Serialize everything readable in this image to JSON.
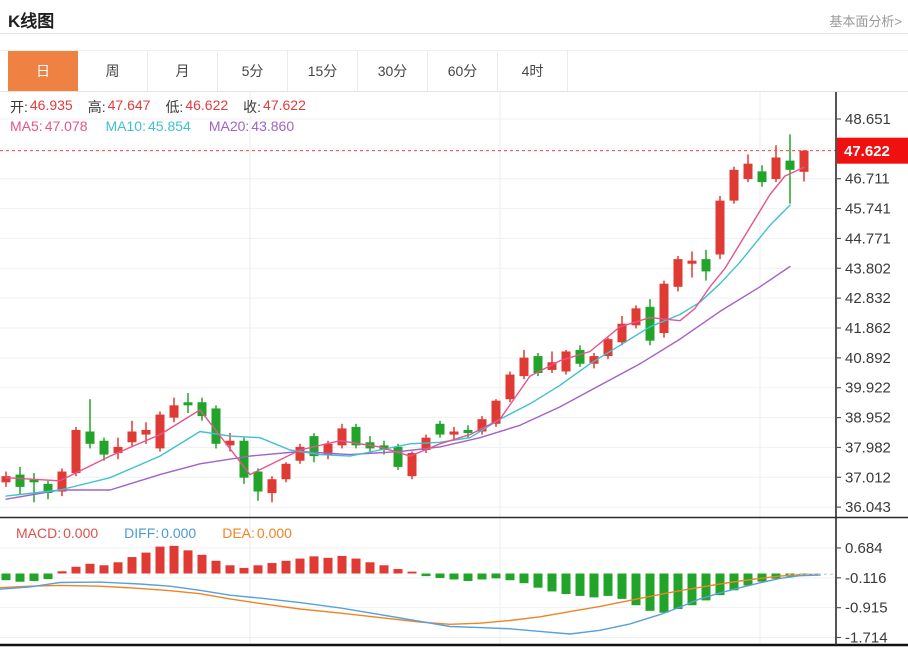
{
  "header": {
    "title": "K线图",
    "link": "基本面分析>"
  },
  "tabs": {
    "items": [
      "日",
      "周",
      "月",
      "5分",
      "15分",
      "30分",
      "60分",
      "4时"
    ],
    "active_index": 0,
    "active_bg": "#ef8143"
  },
  "ohlc": {
    "value_color": "#e13c3c",
    "items": [
      {
        "label": "开:",
        "value": "46.935"
      },
      {
        "label": "高:",
        "value": "47.647"
      },
      {
        "label": "低:",
        "value": "46.622"
      },
      {
        "label": "收:",
        "value": "47.622"
      }
    ]
  },
  "ma": {
    "items": [
      {
        "label": "MA5:",
        "value": "47.078",
        "color": "#e7548c"
      },
      {
        "label": "MA10:",
        "value": "45.854",
        "color": "#3fc1cf"
      },
      {
        "label": "MA20:",
        "value": "43.860",
        "color": "#a263c4"
      }
    ]
  },
  "macd_header": {
    "items": [
      {
        "label": "MACD:",
        "value": "0.000",
        "color": "#dc5050"
      },
      {
        "label": "DIFF:",
        "value": "0.000",
        "color": "#4a9ad4"
      },
      {
        "label": "DEA:",
        "value": "0.000",
        "color": "#ef8426"
      }
    ]
  },
  "price_badge": {
    "value": "47.622",
    "bg": "#f11010",
    "line_color": "#ff4242"
  },
  "chart_data": [
    {
      "type": "candlestick",
      "title": "K线图",
      "current_price": 47.622,
      "y_tick_values": [
        48.651,
        47.681,
        46.711,
        45.741,
        44.771,
        43.802,
        42.832,
        41.862,
        40.892,
        39.922,
        38.952,
        37.982,
        37.012,
        36.043
      ],
      "y_tick_labels": [
        "48.651",
        "",
        "46.711",
        "45.741",
        "44.771",
        "43.802",
        "42.832",
        "41.862",
        "40.892",
        "39.922",
        "38.952",
        "37.982",
        "37.012",
        "36.043"
      ],
      "badge_tick_index": 1,
      "x_gridlines": [
        250,
        500,
        760
      ],
      "colors": {
        "up": "#df3a33",
        "down": "#22a42a"
      },
      "candles": [
        [
          36.85,
          37.2,
          36.7,
          37.05
        ],
        [
          37.1,
          37.35,
          36.45,
          36.7
        ],
        [
          36.95,
          37.15,
          36.2,
          36.85
        ],
        [
          36.8,
          36.9,
          36.3,
          36.5
        ],
        [
          36.55,
          37.3,
          36.4,
          37.2
        ],
        [
          37.15,
          38.65,
          37.05,
          38.55
        ],
        [
          38.5,
          39.55,
          37.95,
          38.1
        ],
        [
          38.2,
          38.3,
          37.55,
          37.75
        ],
        [
          37.8,
          38.3,
          37.6,
          38.0
        ],
        [
          38.15,
          38.85,
          38.0,
          38.5
        ],
        [
          38.4,
          38.8,
          38.1,
          38.55
        ],
        [
          37.95,
          39.15,
          37.85,
          39.05
        ],
        [
          38.95,
          39.6,
          38.8,
          39.35
        ],
        [
          39.45,
          39.75,
          39.1,
          39.35
        ],
        [
          39.45,
          39.6,
          38.85,
          39.0
        ],
        [
          39.25,
          39.35,
          37.95,
          38.1
        ],
        [
          38.05,
          38.45,
          37.85,
          38.2
        ],
        [
          38.2,
          38.3,
          36.8,
          37.0
        ],
        [
          37.2,
          37.3,
          36.25,
          36.55
        ],
        [
          36.5,
          37.05,
          36.2,
          36.95
        ],
        [
          36.95,
          37.5,
          36.85,
          37.45
        ],
        [
          37.55,
          38.1,
          37.45,
          38.0
        ],
        [
          38.35,
          38.45,
          37.5,
          37.7
        ],
        [
          37.75,
          38.2,
          37.6,
          38.1
        ],
        [
          38.05,
          38.75,
          37.95,
          38.6
        ],
        [
          38.65,
          38.75,
          37.95,
          38.05
        ],
        [
          38.15,
          38.35,
          37.85,
          37.95
        ],
        [
          38.05,
          38.2,
          37.75,
          37.9
        ],
        [
          38.0,
          38.1,
          37.25,
          37.35
        ],
        [
          37.05,
          37.85,
          36.95,
          37.8
        ],
        [
          37.9,
          38.4,
          37.8,
          38.3
        ],
        [
          38.75,
          38.85,
          38.3,
          38.4
        ],
        [
          38.4,
          38.65,
          38.25,
          38.5
        ],
        [
          38.55,
          38.7,
          38.3,
          38.45
        ],
        [
          38.5,
          39.0,
          38.4,
          38.9
        ],
        [
          38.75,
          39.55,
          38.65,
          39.5
        ],
        [
          39.55,
          40.45,
          39.45,
          40.35
        ],
        [
          40.3,
          41.15,
          40.2,
          40.9
        ],
        [
          40.95,
          41.05,
          40.3,
          40.4
        ],
        [
          40.5,
          41.1,
          40.4,
          40.75
        ],
        [
          40.45,
          41.15,
          40.35,
          41.1
        ],
        [
          41.15,
          41.3,
          40.6,
          40.7
        ],
        [
          40.7,
          41.05,
          40.55,
          40.95
        ],
        [
          40.95,
          41.55,
          40.85,
          41.5
        ],
        [
          41.4,
          42.25,
          41.3,
          42.0
        ],
        [
          41.95,
          42.6,
          41.85,
          42.5
        ],
        [
          42.55,
          42.8,
          41.3,
          41.45
        ],
        [
          41.7,
          43.4,
          41.55,
          43.3
        ],
        [
          43.2,
          44.2,
          43.05,
          44.1
        ],
        [
          43.95,
          44.35,
          43.5,
          44.05
        ],
        [
          44.1,
          44.4,
          43.4,
          43.7
        ],
        [
          44.25,
          46.15,
          44.1,
          46.0
        ],
        [
          46.0,
          47.1,
          45.9,
          47.0
        ],
        [
          46.7,
          47.5,
          46.6,
          47.2
        ],
        [
          46.95,
          47.15,
          46.45,
          46.6
        ],
        [
          46.7,
          47.8,
          46.6,
          47.4
        ],
        [
          47.3,
          48.15,
          45.9,
          47.0
        ],
        [
          46.935,
          47.647,
          46.622,
          47.622
        ]
      ],
      "ma5_points": [
        [
          6,
          37.0
        ],
        [
          60,
          36.9
        ],
        [
          110,
          37.7
        ],
        [
          160,
          38.4
        ],
        [
          200,
          39.2
        ],
        [
          250,
          37.1
        ],
        [
          300,
          37.9
        ],
        [
          340,
          38.2
        ],
        [
          380,
          38.0
        ],
        [
          410,
          37.7
        ],
        [
          440,
          38.1
        ],
        [
          470,
          38.4
        ],
        [
          500,
          38.9
        ],
        [
          530,
          40.3
        ],
        [
          560,
          40.8
        ],
        [
          590,
          41.1
        ],
        [
          620,
          41.9
        ],
        [
          650,
          42.2
        ],
        [
          680,
          42.1
        ],
        [
          695,
          42.5
        ],
        [
          710,
          43.2
        ],
        [
          725,
          43.8
        ],
        [
          740,
          44.6
        ],
        [
          755,
          45.4
        ],
        [
          770,
          46.2
        ],
        [
          785,
          46.8
        ],
        [
          804,
          47.078
        ]
      ],
      "ma10_points": [
        [
          6,
          36.4
        ],
        [
          60,
          36.6
        ],
        [
          110,
          37.0
        ],
        [
          160,
          37.7
        ],
        [
          200,
          38.5
        ],
        [
          230,
          38.35
        ],
        [
          260,
          38.3
        ],
        [
          290,
          37.9
        ],
        [
          320,
          37.75
        ],
        [
          350,
          37.7
        ],
        [
          380,
          37.9
        ],
        [
          410,
          38.1
        ],
        [
          440,
          38.15
        ],
        [
          470,
          38.3
        ],
        [
          500,
          38.9
        ],
        [
          530,
          39.4
        ],
        [
          560,
          40.0
        ],
        [
          590,
          40.7
        ],
        [
          620,
          41.3
        ],
        [
          650,
          41.9
        ],
        [
          680,
          42.3
        ],
        [
          700,
          42.7
        ],
        [
          720,
          43.3
        ],
        [
          740,
          44.0
        ],
        [
          755,
          44.6
        ],
        [
          770,
          45.2
        ],
        [
          790,
          45.854
        ]
      ],
      "ma20_points": [
        [
          6,
          36.3
        ],
        [
          60,
          36.6
        ],
        [
          110,
          36.6
        ],
        [
          160,
          37.1
        ],
        [
          200,
          37.45
        ],
        [
          250,
          37.7
        ],
        [
          300,
          37.85
        ],
        [
          350,
          37.75
        ],
        [
          400,
          37.85
        ],
        [
          440,
          38.0
        ],
        [
          480,
          38.3
        ],
        [
          520,
          38.7
        ],
        [
          560,
          39.3
        ],
        [
          600,
          40.0
        ],
        [
          640,
          40.7
        ],
        [
          680,
          41.5
        ],
        [
          720,
          42.4
        ],
        [
          760,
          43.2
        ],
        [
          790,
          43.86
        ]
      ]
    },
    {
      "type": "macd",
      "y_tick_values": [
        0.684,
        -0.116,
        -0.915,
        -1.714
      ],
      "y_tick_labels": [
        "0.684",
        "-0.116",
        "-0.915",
        "-1.714"
      ],
      "colors": {
        "positive": "#df3a33",
        "negative": "#22a42a",
        "diff": "#58a0dc",
        "dea": "#ef8426",
        "dashed_right": "#a9cbe4"
      },
      "histogram": [
        -0.18,
        -0.22,
        -0.2,
        -0.15,
        0.06,
        0.18,
        0.26,
        0.22,
        0.3,
        0.44,
        0.56,
        0.72,
        0.74,
        0.62,
        0.5,
        0.34,
        0.22,
        0.15,
        0.22,
        0.28,
        0.34,
        0.4,
        0.46,
        0.42,
        0.47,
        0.4,
        0.3,
        0.22,
        0.12,
        0.05,
        -0.07,
        -0.12,
        -0.16,
        -0.2,
        -0.16,
        -0.13,
        -0.18,
        -0.26,
        -0.38,
        -0.48,
        -0.55,
        -0.6,
        -0.64,
        -0.6,
        -0.68,
        -0.85,
        -1.0,
        -1.05,
        -0.95,
        -0.85,
        -0.72,
        -0.58,
        -0.45,
        -0.32,
        -0.22,
        -0.14,
        -0.08,
        -0.03
      ],
      "diff_points": [
        [
          0,
          -0.42
        ],
        [
          30,
          -0.36
        ],
        [
          60,
          -0.24
        ],
        [
          100,
          -0.23
        ],
        [
          140,
          -0.28
        ],
        [
          170,
          -0.34
        ],
        [
          200,
          -0.45
        ],
        [
          230,
          -0.58
        ],
        [
          260,
          -0.66
        ],
        [
          300,
          -0.78
        ],
        [
          340,
          -0.92
        ],
        [
          380,
          -1.1
        ],
        [
          420,
          -1.28
        ],
        [
          450,
          -1.42
        ],
        [
          480,
          -1.45
        ],
        [
          510,
          -1.48
        ],
        [
          540,
          -1.55
        ],
        [
          570,
          -1.62
        ],
        [
          600,
          -1.52
        ],
        [
          630,
          -1.35
        ],
        [
          660,
          -1.1
        ],
        [
          680,
          -0.9
        ],
        [
          700,
          -0.68
        ],
        [
          720,
          -0.52
        ],
        [
          740,
          -0.38
        ],
        [
          760,
          -0.25
        ],
        [
          780,
          -0.13
        ],
        [
          800,
          -0.06
        ],
        [
          820,
          -0.04
        ]
      ],
      "dea_points": [
        [
          0,
          -0.38
        ],
        [
          30,
          -0.34
        ],
        [
          60,
          -0.32
        ],
        [
          100,
          -0.34
        ],
        [
          140,
          -0.4
        ],
        [
          170,
          -0.46
        ],
        [
          200,
          -0.54
        ],
        [
          230,
          -0.68
        ],
        [
          260,
          -0.8
        ],
        [
          300,
          -0.95
        ],
        [
          340,
          -1.06
        ],
        [
          380,
          -1.18
        ],
        [
          420,
          -1.3
        ],
        [
          450,
          -1.36
        ],
        [
          480,
          -1.33
        ],
        [
          510,
          -1.26
        ],
        [
          540,
          -1.16
        ],
        [
          570,
          -1.02
        ],
        [
          600,
          -0.88
        ],
        [
          630,
          -0.72
        ],
        [
          660,
          -0.56
        ],
        [
          680,
          -0.46
        ],
        [
          700,
          -0.37
        ],
        [
          720,
          -0.28
        ],
        [
          740,
          -0.2
        ],
        [
          760,
          -0.13
        ],
        [
          780,
          -0.07
        ],
        [
          800,
          -0.03
        ],
        [
          820,
          -0.02
        ]
      ]
    }
  ]
}
